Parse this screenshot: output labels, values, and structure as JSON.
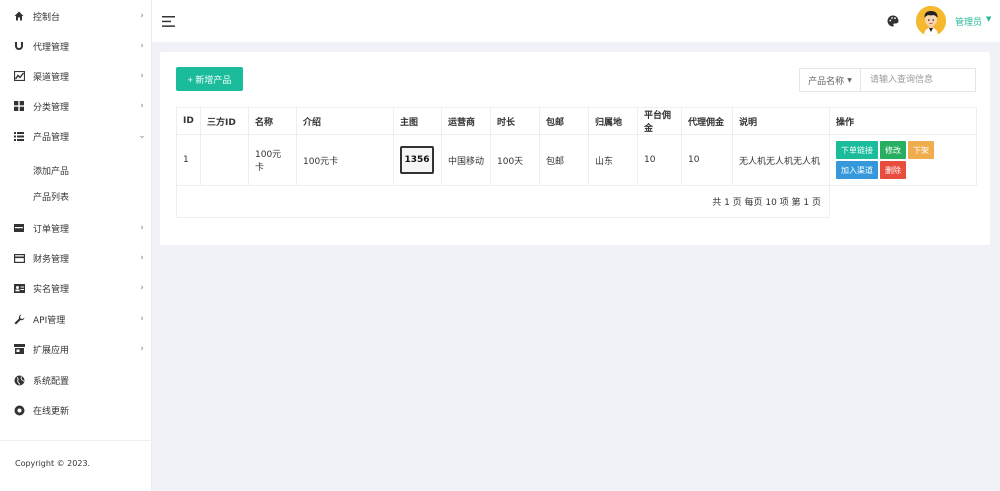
{
  "sidebar": {
    "items": [
      {
        "label": "控制台",
        "icon": "home-icon",
        "has_arrow": true
      },
      {
        "label": "代理管理",
        "icon": "magnet-icon",
        "has_arrow": true
      },
      {
        "label": "渠道管理",
        "icon": "chart-icon",
        "has_arrow": true
      },
      {
        "label": "分类管理",
        "icon": "grid-icon",
        "has_arrow": true
      },
      {
        "label": "产品管理",
        "icon": "list-icon",
        "has_arrow": true,
        "expanded": true
      },
      {
        "label": "订单管理",
        "icon": "bar-icon",
        "has_arrow": true
      },
      {
        "label": "财务管理",
        "icon": "card-icon",
        "has_arrow": true
      },
      {
        "label": "实名管理",
        "icon": "id-card-icon",
        "has_arrow": true
      },
      {
        "label": "API管理",
        "icon": "wrench-icon",
        "has_arrow": true
      },
      {
        "label": "扩展应用",
        "icon": "store-icon",
        "has_arrow": true
      },
      {
        "label": "系统配置",
        "icon": "globe-icon",
        "has_arrow": false
      },
      {
        "label": "在线更新",
        "icon": "circle-icon",
        "has_arrow": false
      }
    ],
    "submenu": [
      "添加产品",
      "产品列表"
    ],
    "copyright": "Copyright © 2023."
  },
  "topbar": {
    "user_name": "管理员"
  },
  "toolbar": {
    "add_label": "+ 新增产品",
    "search_type": "产品名称",
    "search_placeholder": "请输入查询信息"
  },
  "table": {
    "columns": [
      "ID",
      "三方ID",
      "名称",
      "介绍",
      "主图",
      "运营商",
      "时长",
      "包邮",
      "归属地",
      "平台佣金",
      "代理佣金",
      "说明",
      "操作"
    ],
    "rows": [
      {
        "id": "1",
        "third_id": "",
        "name": "100元卡",
        "intro": "100元卡",
        "image_text": "1356",
        "operator": "中国移动",
        "duration": "100天",
        "shipping": "包邮",
        "location": "山东",
        "platform_commission": "10",
        "agent_commission": "10",
        "note": "无人机无人机无人机"
      }
    ],
    "actions": [
      "下单链接",
      "修改",
      "下架",
      "加入渠道",
      "删除"
    ],
    "pagination": "共 1 页  每页 10 项   第 1 页"
  },
  "colors": {
    "accent": "#1abc9c",
    "user": "#26b99a",
    "danger": "#e74c3c",
    "warning": "#f0ad4e",
    "info": "#3498db"
  }
}
